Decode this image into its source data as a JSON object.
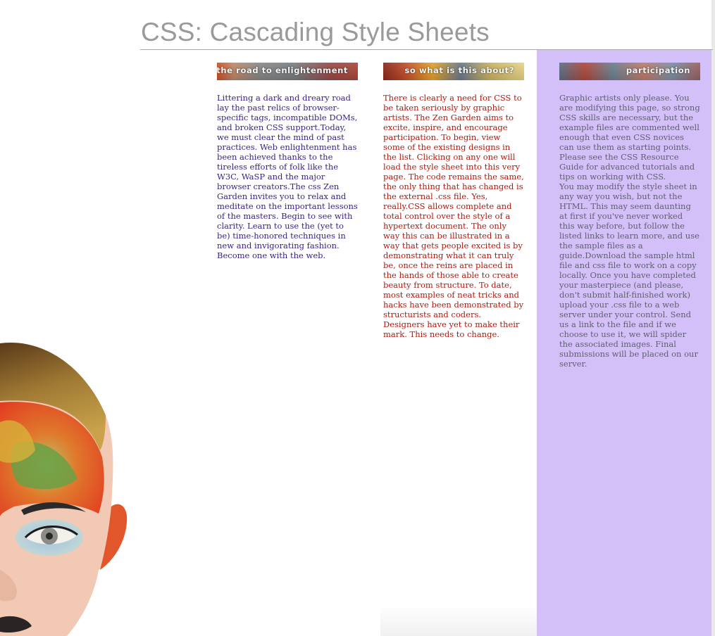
{
  "page": {
    "title": "CSS: Cascading Style Sheets"
  },
  "colors": {
    "title": "#9a9a9a",
    "sidebar_bg": "#d4c0f8",
    "col1_text": "#3a1e86",
    "col2_text": "#b01a0e",
    "col3_text": "#5f5f6e"
  },
  "columns": [
    {
      "heading": "the road to enlightenment",
      "text": "Littering a dark and dreary road lay the past relics of browser-specific tags, incompatible DOMs, and broken CSS support.Today, we must clear the mind of past practices. Web enlightenment has been achieved thanks to the tireless efforts of folk like the W3C, WaSP and the major browser creators.The css Zen Garden invites you to relax and meditate on the important lessons of the masters. Begin to see with clarity. Learn to use the (yet to be) time-honored techniques in new and invigorating fashion. Become one with the web."
    },
    {
      "heading": "so what is this about?",
      "text": "There is clearly a need for CSS to be taken seriously by graphic artists. The Zen Garden aims to excite, inspire, and encourage participation. To begin, view some of the existing designs in the list. Clicking on any one will load the style sheet into this very page. The code remains the same, the only thing that has changed is the external .css file. Yes, really.CSS allows complete and total control over the style of a hypertext document. The only way this can be illustrated in a way that gets people excited is by demonstrating what it can truly be, once the reins are placed in the hands of those able to create beauty from structure. To date, most examples of neat tricks and hacks have been demonstrated by structurists and coders. Designers have yet to make their mark. This needs to change."
    },
    {
      "heading": "participation",
      "paragraphs": [
        "Graphic artists only please. You are modifying this page, so strong CSS skills are necessary, but the example files are commented well enough that even CSS novices can use them as starting points. Please see the CSS Resource Guide for advanced tutorials and tips on working with CSS.",
        "You may modify the style sheet in any way you wish, but not the HTML. This may seem daunting at first if you've never worked this way before, but follow the listed links to learn more, and use the sample files as a guide.Download the sample html file and css file to work on a copy locally. Once you have completed your masterpiece (and please, don't submit half-finished work) upload your .css file to a web server under your control. Send us a link to the file and if we choose to use it, we will spider the associated images. Final submissions will be placed on our server."
      ]
    }
  ],
  "images": {
    "face": "painted-face-illustration"
  }
}
